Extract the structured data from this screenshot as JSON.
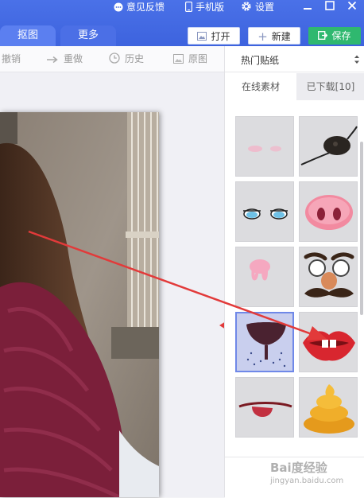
{
  "titlebar": {
    "feedback": "意见反馈",
    "mobile": "手机版",
    "settings": "设置"
  },
  "tabs": [
    {
      "label": "抠图"
    },
    {
      "label": "更多"
    }
  ],
  "actions": {
    "open": "打开",
    "new": "新建",
    "save": "保存"
  },
  "toolbar": {
    "undo": "撤销",
    "redo": "重做",
    "history": "历史",
    "original": "原图"
  },
  "panel": {
    "category": "热门贴纸",
    "tab_online": "在线素材",
    "tab_downloaded": "已下载[10]"
  },
  "stickers": [
    {
      "icon": "blush-sticker-icon"
    },
    {
      "icon": "eyepatch-sticker-icon"
    },
    {
      "icon": "teary-eyes-sticker-icon"
    },
    {
      "icon": "pig-nose-sticker-icon"
    },
    {
      "icon": "pink-drool-sticker-icon"
    },
    {
      "icon": "nose-glasses-mustache-sticker-icon"
    },
    {
      "icon": "wine-glass-sticker-icon",
      "selected": true
    },
    {
      "icon": "red-lips-teeth-sticker-icon"
    },
    {
      "icon": "tongue-sticker-icon"
    },
    {
      "icon": "poop-sticker-icon"
    }
  ],
  "watermark": {
    "line1": "Bai度经验",
    "line2": "jingyan.baidu.com"
  },
  "colors": {
    "titlebar": "#4068e2",
    "save_button": "#2fb86f",
    "annotation_arrow": "#e23a3a",
    "selected_sticker_border": "#6f88e8"
  }
}
